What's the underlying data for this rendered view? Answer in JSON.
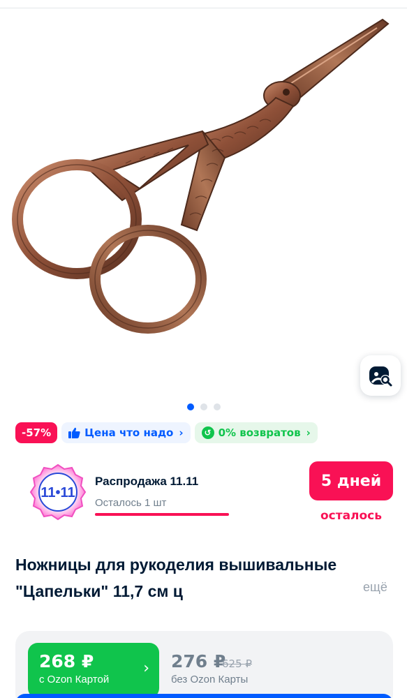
{
  "gallery": {
    "image_alt": "product-photo-scissors",
    "dots": [
      true,
      false,
      false
    ]
  },
  "badges": {
    "discount": "-57%",
    "price": "Цена что надо",
    "returns": "0% возвратов"
  },
  "sale": {
    "logo_text": "11•11",
    "title": "Распродажа 11.11",
    "stock": "Осталось 1 шт",
    "days": "5 дней",
    "days_suffix": "осталось"
  },
  "product": {
    "title": "Ножницы для рукоделия вышивальные \"Цапельки\" 11,7 см ц",
    "more": "ещё"
  },
  "price": {
    "card_price": "268 ₽",
    "card_label": "с Ozon Картой",
    "regular_price": "276 ₽",
    "old_price": "625 ₽",
    "regular_label": "без Ozon Карты"
  },
  "colors": {
    "accent": "#005bff",
    "sale": "#f91155",
    "green": "#10c44c",
    "copper": "#a0644a"
  }
}
